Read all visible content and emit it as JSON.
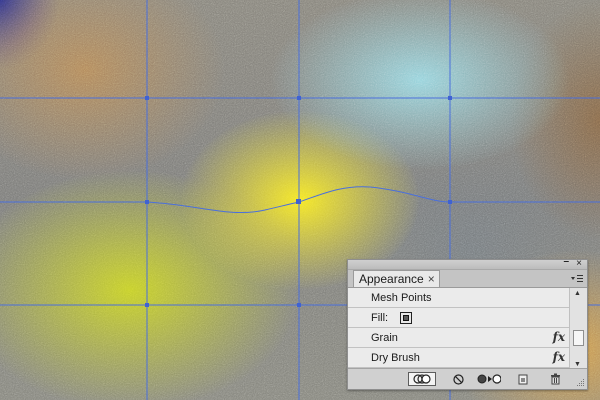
{
  "canvas": {
    "grid_color": "#4a6fdc",
    "anchor_color": "#3f62d2"
  },
  "appearance_panel": {
    "tab_label": "Appearance",
    "tab_close": "×",
    "collapse": "–",
    "close": "×",
    "rows": [
      {
        "label": "Mesh Points",
        "has_fx": false,
        "has_swatch": false
      },
      {
        "label": "Fill:",
        "has_fx": false,
        "has_swatch": true
      },
      {
        "label": "Grain",
        "has_fx": true,
        "has_swatch": false
      },
      {
        "label": "Dry Brush",
        "has_fx": true,
        "has_swatch": false
      }
    ],
    "fx_symbol": "fx",
    "footer_icons": [
      "new-art-has-basic-appearance-icon",
      "clear-appearance-icon",
      "reduce-to-basic-appearance-icon",
      "duplicate-item-icon",
      "delete-item-icon"
    ]
  }
}
